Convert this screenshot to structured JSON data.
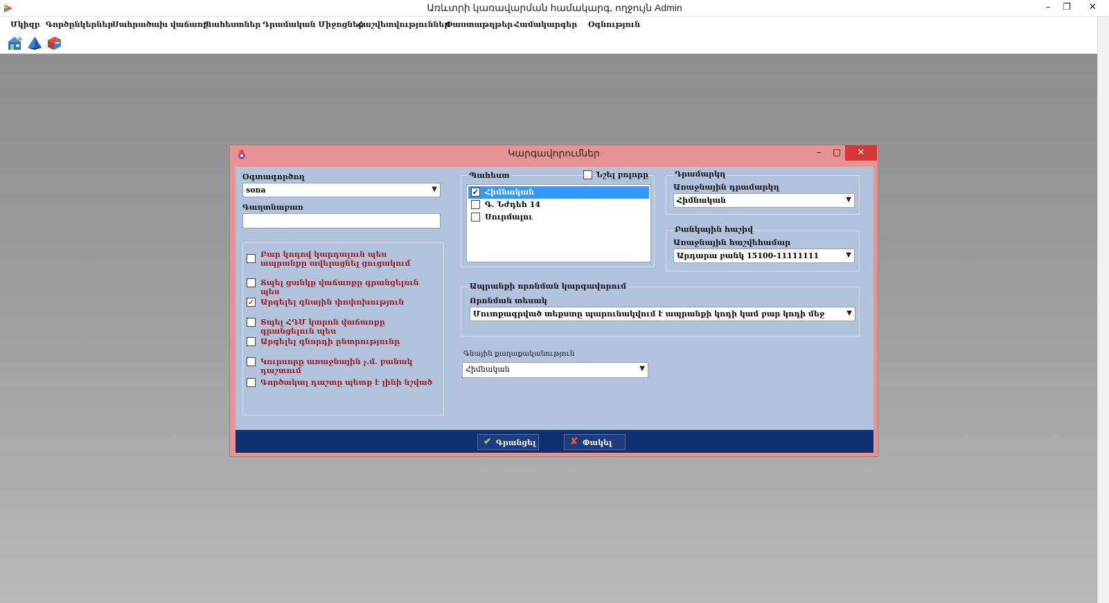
{
  "window": {
    "title": "Առևտրի կառավարման համակարգ, ողջույն Admin",
    "minimize": "–",
    "maximize": "❐",
    "close": "✕"
  },
  "menu": [
    "Մկիզբ",
    "Գործընկերներ",
    "Սահրածախ վաճառք",
    "Պահեստներ",
    "Դրամական Միջոցներ",
    "Հաշվետվություններ",
    "Փաստաթղթեր",
    "Համակարգեր",
    "Օգնություն"
  ],
  "toolbar": [
    {
      "icon": "store-icon"
    },
    {
      "icon": "pyramid-icon"
    },
    {
      "icon": "book-icon"
    }
  ],
  "dialog": {
    "title": "Կարգավորումներ",
    "minimize": "–",
    "maximize": "▢",
    "close": "✕",
    "user": {
      "label": "Օգտագործող",
      "value": "sona"
    },
    "password": {
      "label": "Գաղտնաբառ",
      "value": ""
    },
    "options": [
      {
        "label": "Բար կոդով կարդալուն պես ապրանքը ավելացնել ցուցակում",
        "checked": false
      },
      {
        "label": "Տպել ցանկը վաճառքը գրանցելուն պես",
        "checked": false
      },
      {
        "label": "Արգելել գնային փոփոխություն",
        "checked": true
      },
      {
        "label": "Տպել ՀԴՄ կտրոն վաճառքը գրանցելուն պես",
        "checked": false
      },
      {
        "label": "Արգելել գնորդի ընտրությունը",
        "checked": false
      },
      {
        "label": "Կուրսորը առաջնային չ.մ. բանակ դաշտում",
        "checked": false
      },
      {
        "label": "Գործակալ դաշտը պետք է լինի նշված",
        "checked": false
      }
    ],
    "warehouse": {
      "label": "Պահեստ",
      "select_all_label": "Նշել բոլորը",
      "select_all_checked": false,
      "items": [
        {
          "label": "Հիմնական",
          "checked": true,
          "selected": true
        },
        {
          "label": "Գ. Նժդեհ 14",
          "checked": false,
          "selected": false
        },
        {
          "label": "Սուրմալու",
          "checked": false,
          "selected": false
        }
      ]
    },
    "cashbox": {
      "group_label": "Դրամարկղ",
      "field_label": "Առաջնային դրամարկղ",
      "value": "Հիմնական"
    },
    "bank": {
      "group_label": "Բանկային հաշիվ",
      "field_label": "Առաջնային հաշվեհամար",
      "value": "Արդարա բանկ 15100-11111111"
    },
    "search": {
      "group_label": "Ապրանքի որոնման կարգավորում",
      "field_label": "Որոնման տեսակ",
      "value": "Մուտքագրված տեքստը պարունակվում է ապրանքի կոդի կամ բար կոդի մեջ"
    },
    "price_policy": {
      "label": "Գնային քաղաքականություն",
      "value": "Հիմնական"
    },
    "save_label": "Գրանցել",
    "close_label": "Փակել"
  }
}
